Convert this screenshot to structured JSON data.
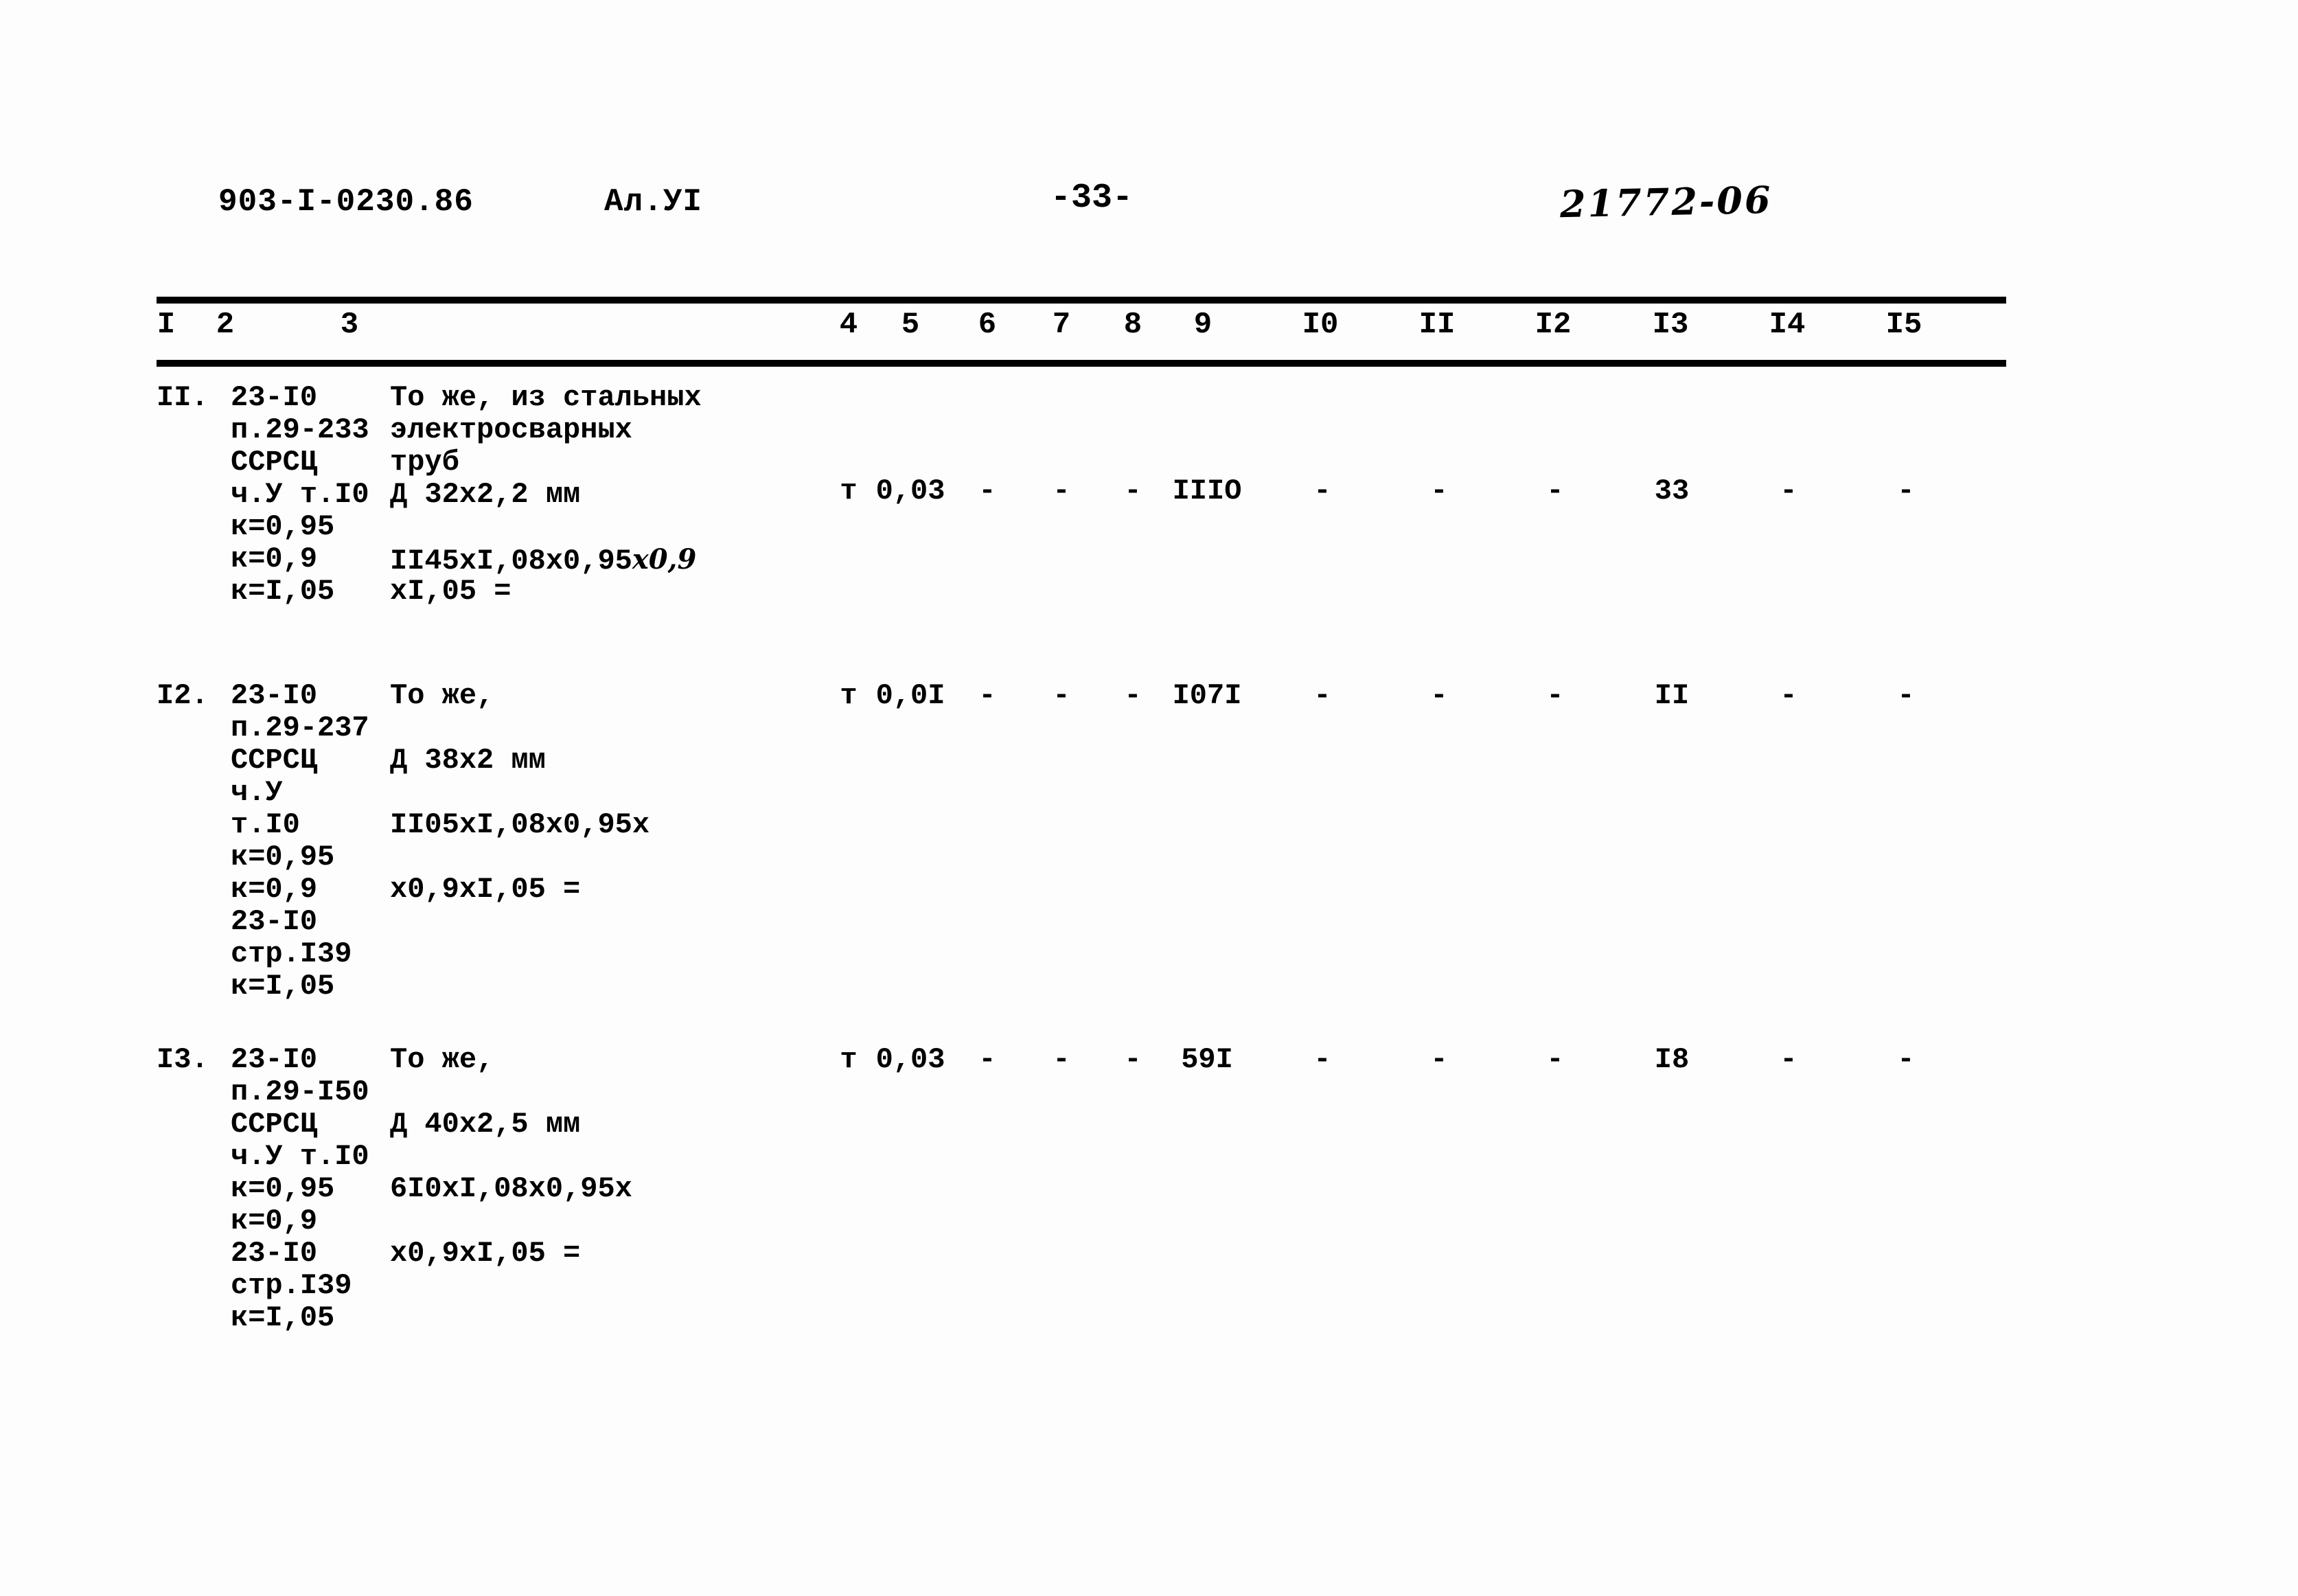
{
  "header": {
    "doc_code": "903-I-0230.86",
    "album": "Ал.УI",
    "page_number": "-33-",
    "stamp": "21772-06"
  },
  "table": {
    "column_headers": [
      "I",
      "2",
      "3",
      "4",
      "5",
      "6",
      "7",
      "8",
      "9",
      "I0",
      "II",
      "I2",
      "I3",
      "I4",
      "I5"
    ],
    "rows": [
      {
        "num": "II.",
        "code_lines": [
          "23-I0",
          "п.29-233",
          "ССРСЦ",
          "ч.У т.I0",
          "к=0,95",
          "к=0,9",
          "к=I,05"
        ],
        "desc_lines": [
          "То же, из стальных",
          "электросварных",
          "труб",
          "Д 32х2,2 мм",
          "",
          "II45хI,08х0,95",
          "хI,05 ="
        ],
        "desc_hand": "х0,9",
        "unit": "т",
        "values": [
          "0,03",
          "-",
          "-",
          "-",
          "IIIO",
          "-",
          "-",
          "-",
          "33",
          "-",
          "-"
        ]
      },
      {
        "num": "I2.",
        "code_lines": [
          "23-I0",
          "п.29-237",
          "ССРСЦ",
          "ч.У",
          "т.I0",
          "к=0,95",
          "к=0,9",
          "23-I0",
          "стр.I39",
          "к=I,05"
        ],
        "desc_lines": [
          "То же,",
          "",
          "Д 38х2 мм",
          "",
          "II05хI,08х0,95х",
          "",
          "х0,9хI,05 ="
        ],
        "desc_hand": "",
        "unit": "т",
        "values": [
          "0,0I",
          "-",
          "-",
          "-",
          "I07I",
          "-",
          "-",
          "-",
          "II",
          "-",
          "-"
        ]
      },
      {
        "num": "I3.",
        "code_lines": [
          "23-I0",
          "п.29-I50",
          "ССРСЦ",
          "ч.У т.I0",
          "к=0,95",
          "к=0,9",
          "23-I0",
          "стр.I39",
          "к=I,05"
        ],
        "desc_lines": [
          "То же,",
          "",
          "Д 40х2,5 мм",
          "",
          "6I0хI,08х0,95х",
          "",
          "х0,9хI,05 ="
        ],
        "desc_hand": "",
        "unit": "т",
        "values": [
          "0,03",
          "-",
          "-",
          "-",
          "59I",
          "-",
          "-",
          "-",
          "I8",
          "-",
          "-"
        ]
      }
    ]
  }
}
